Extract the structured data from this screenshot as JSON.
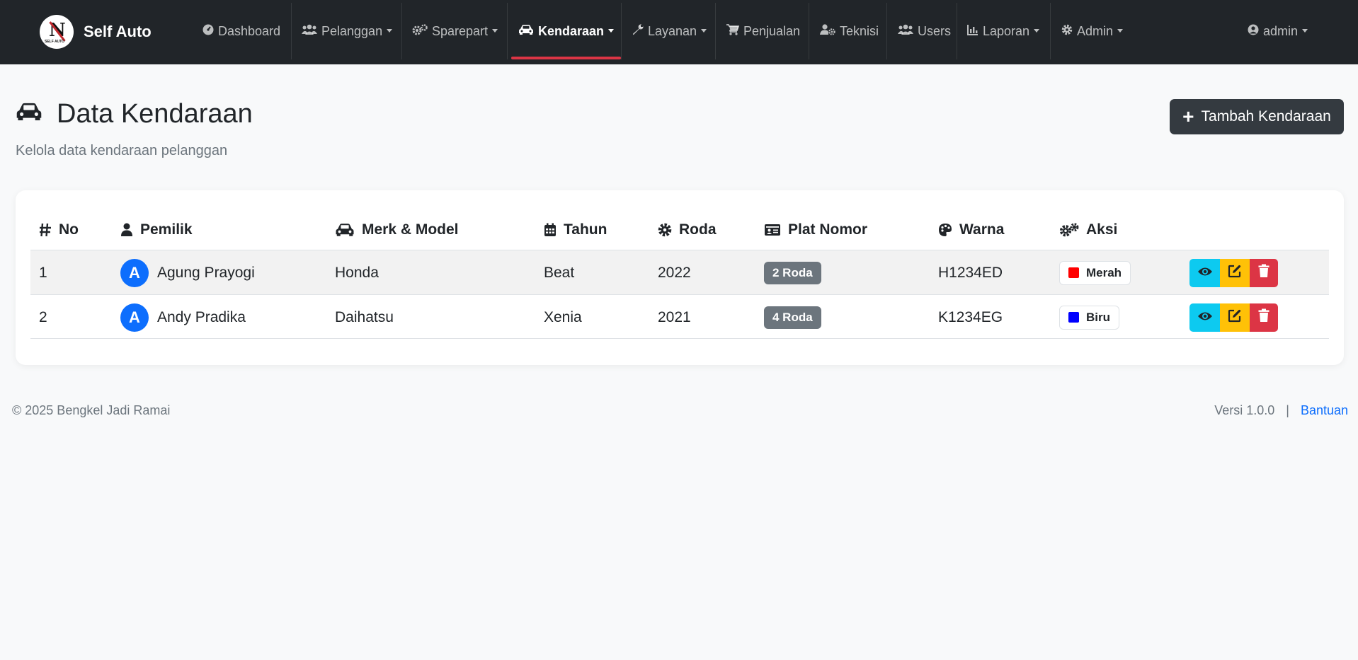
{
  "brand": {
    "name": "Self Auto",
    "logo_letter": "N",
    "logo_small": "SELF AUTO"
  },
  "nav": {
    "dashboard": "Dashboard",
    "pelanggan": "Pelanggan",
    "sparepart": "Sparepart",
    "kendaraan": "Kendaraan",
    "layanan": "Layanan",
    "penjualan": "Penjualan",
    "teknisi": "Teknisi",
    "users": "Users",
    "laporan": "Laporan",
    "admin": "Admin",
    "user": "admin"
  },
  "page": {
    "title": "Data Kendaraan",
    "subtitle": "Kelola data kendaraan pelanggan",
    "add_button": "Tambah Kendaraan"
  },
  "table": {
    "headers": {
      "no": "No",
      "pemilik": "Pemilik",
      "merk": "Merk & Model",
      "tahun": "Tahun",
      "roda": "Roda",
      "plat": "Plat Nomor",
      "warna": "Warna",
      "aksi": "Aksi"
    },
    "rows": [
      {
        "no": "1",
        "initial": "A",
        "owner": "Agung Prayogi",
        "merk": "Honda",
        "model": "Beat",
        "year": "2022",
        "wheels": "2 Roda",
        "plate": "H1234ED",
        "color_name": "Merah",
        "color_hex": "#ff0000"
      },
      {
        "no": "2",
        "initial": "A",
        "owner": "Andy Pradika",
        "merk": "Daihatsu",
        "model": "Xenia",
        "year": "2021",
        "wheels": "4 Roda",
        "plate": "K1234EG",
        "color_name": "Biru",
        "color_hex": "#0000ff"
      }
    ]
  },
  "footer": {
    "copyright": "© 2025 Bengkel Jadi Ramai",
    "version": "Versi 1.0.0",
    "separator": "|",
    "help": "Bantuan"
  },
  "colors": {
    "navbar_bg": "#212529",
    "active_underline": "#dc3545",
    "view_button": "#0dcaf0",
    "edit_button": "#ffc107",
    "delete_button": "#dc3545",
    "avatar": "#0d6efd",
    "badge_roda": "#6c757d"
  }
}
